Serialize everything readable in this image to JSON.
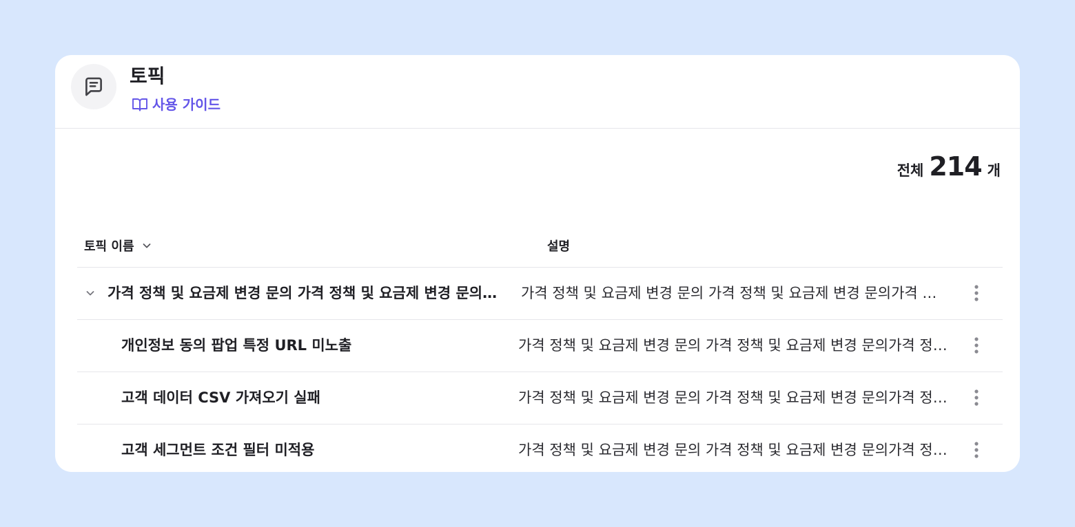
{
  "header": {
    "icon": "message-square-text-icon",
    "title": "토픽",
    "guide_icon": "book-open-icon",
    "guide_label": "사용 가이드"
  },
  "summary": {
    "prefix": "전체",
    "count": "214",
    "suffix": "개"
  },
  "table": {
    "columns": {
      "name": "토픽 이름",
      "name_sort_icon": "chevron-down-icon",
      "description": "설명"
    },
    "rows": [
      {
        "name": "가격 정책 및 요금제 변경 문의 가격 정책 및 요금제 변경 문의가격 정책 및 요금제 변경 문의",
        "description": "가격 정책 및 요금제 변경 문의 가격 정책 및 요금제 변경 문의가격 정책 및 요금제 변경 문의",
        "expanded": true
      },
      {
        "name": "개인정보 동의 팝업 특정 URL 미노출",
        "description": "가격 정책 및 요금제 변경 문의 가격 정책 및 요금제 변경 문의가격 정책 및 요금제 변경 문의"
      },
      {
        "name": "고객 데이터 CSV 가져오기 실패",
        "description": "가격 정책 및 요금제 변경 문의 가격 정책 및 요금제 변경 문의가격 정책 및 요금제 변경 문의"
      },
      {
        "name": "고객 세그먼트 조건 필터 미적용",
        "description": "가격 정책 및 요금제 변경 문의 가격 정책 및 요금제 변경 문의가격 정책 및 요금제 변경 문의"
      }
    ]
  },
  "colors": {
    "background": "#d8e7fd",
    "accent": "#6355e8",
    "divider": "#e6e6ea"
  }
}
